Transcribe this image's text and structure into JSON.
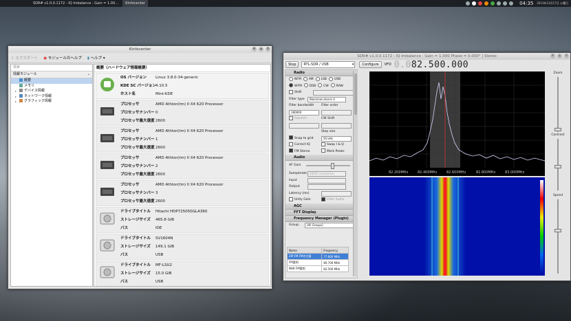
{
  "taskbar": {
    "tasks": [
      "SDR# v1.0.0.1172 - IQ Imbalance : Gain = 1.00…",
      "KInfocenter"
    ],
    "clock": "04:35",
    "date": "2013年12月17日 火曜日"
  },
  "kinfo": {
    "title": "KInfocenter",
    "toolbar": {
      "export": "エクスポート",
      "module_help": "モジュールのヘルプ",
      "help": "ヘルプ"
    },
    "search_placeholder": "検索",
    "tree_header": "情報モジュール",
    "tree": [
      {
        "label": "概要",
        "selected": true
      },
      {
        "label": "メモリ"
      },
      {
        "label": "デバイス情報",
        "expandable": true
      },
      {
        "label": "ネットワーク情報",
        "expandable": true
      },
      {
        "label": "グラフィック情報",
        "expandable": true
      }
    ],
    "main_title": "概要（ハードウェア情報概要）",
    "os": {
      "rows": [
        {
          "k": "OS バージョン",
          "v": "Linux 3.8.0-34-generic"
        },
        {
          "k": "KDE SC バージョン",
          "v": "4.10.5"
        },
        {
          "k": "ホスト名",
          "v": "Mint-KDE"
        }
      ]
    },
    "cpus": [
      {
        "rows": [
          {
            "k": "プロセッサ",
            "v": "AMD Athlon(tm) II X4 620 Processor"
          },
          {
            "k": "プロセッサナンバー",
            "v": "0"
          },
          {
            "k": "プロセッサ最大速度",
            "v": "2600"
          }
        ]
      },
      {
        "rows": [
          {
            "k": "プロセッサ",
            "v": "AMD Athlon(tm) II X4 620 Processor"
          },
          {
            "k": "プロセッサナンバー",
            "v": "1"
          },
          {
            "k": "プロセッサ最大速度",
            "v": "2600"
          }
        ]
      },
      {
        "rows": [
          {
            "k": "プロセッサ",
            "v": "AMD Athlon(tm) II X4 620 Processor"
          },
          {
            "k": "プロセッサナンバー",
            "v": "2"
          },
          {
            "k": "プロセッサ最大速度",
            "v": "2600"
          }
        ]
      },
      {
        "rows": [
          {
            "k": "プロセッサ",
            "v": "AMD Athlon(tm) II X4 620 Processor"
          },
          {
            "k": "プロセッサナンバー",
            "v": "3"
          },
          {
            "k": "プロセッサ最大速度",
            "v": "2600"
          }
        ]
      }
    ],
    "drives": [
      {
        "rows": [
          {
            "k": "ドライブタイトル",
            "v": "Hitachi HDP725050GLA360"
          },
          {
            "k": "ストレージサイズ",
            "v": "465.8 GiB"
          },
          {
            "k": "バス",
            "v": "IDE"
          }
        ]
      },
      {
        "rows": [
          {
            "k": "ドライブタイトル",
            "v": "SV1604N"
          },
          {
            "k": "ストレージサイズ",
            "v": "149.1 GiB"
          },
          {
            "k": "バス",
            "v": "USB"
          }
        ]
      },
      {
        "rows": [
          {
            "k": "ドライブタイトル",
            "v": "MF-LSU2"
          },
          {
            "k": "ストレージサイズ",
            "v": "15.0 GiB"
          },
          {
            "k": "バス",
            "v": "USB"
          }
        ]
      }
    ]
  },
  "sdr": {
    "title": "SDR# v1.0.0.1172 - IQ Imbalance : Gain = 1.000 Phase = 0.000° | Stereo",
    "stop": "Stop",
    "device": "RTL-SDR / USB",
    "configure": "Configure",
    "vfo": "VFO",
    "freq_dim": "0.0",
    "freq_main": "82.500.000",
    "radio_section": "Radio",
    "modes1": [
      "NFM",
      "AM",
      "LSB",
      "USB"
    ],
    "modes2": [
      "WFM",
      "DSB",
      "CW",
      "RAW"
    ],
    "selected_mode": "WFM",
    "shift_label": "Shift",
    "filter_type_label": "Filter type",
    "filter_type": "Blackman-Harris 4",
    "filter_bw_label": "Filter bandwidth",
    "filter_order_label": "Filter order",
    "filter_bw": "180000",
    "squelch_label": "Squelch",
    "cw_shift_label": "CW Shift",
    "step_size_label": "Step size",
    "snap_label": "Snap to grid",
    "step_size": "50 kHz",
    "correct_iq": "Correct IQ",
    "swap_iq": "Swap I & Q",
    "fm_stereo": "FM Stereo",
    "mark_peaks": "Mark Peaks",
    "audio_section": "Audio",
    "af_gain": "AF Gain",
    "samplerate_label": "Samplerate",
    "samplerate": "48000 sample/sec",
    "input_label": "Input",
    "output_label": "Output",
    "latency_label": "Latency (ms)",
    "unity_gain": "Unity Gain",
    "filter_audio": "Filter Audio",
    "agc_section": "AGC",
    "fft_section": "FFT Display",
    "fm_section": "Frequency Manager (Plugin)",
    "group_label": "Group:",
    "group_value": "[All Groups]",
    "table_headers": [
      "Name",
      "Frequency"
    ],
    "table_rows": [
      {
        "name": "ZIP-FM FM名古屋",
        "freq": "77.800 MHz",
        "selected": true
      },
      {
        "name": "FM愛知",
        "freq": "80.700 MHz"
      },
      {
        "name": "NHK FM愛知",
        "freq": "82.500 MHz"
      }
    ],
    "freq_ticks": [
      "82.200MHz",
      "82.400MHz",
      "82.600MHz",
      "82.800MHz",
      "83.000MHz"
    ],
    "zoom_label": "Zoom",
    "contrast_label": "Contrast",
    "speed_label": "Speed"
  }
}
